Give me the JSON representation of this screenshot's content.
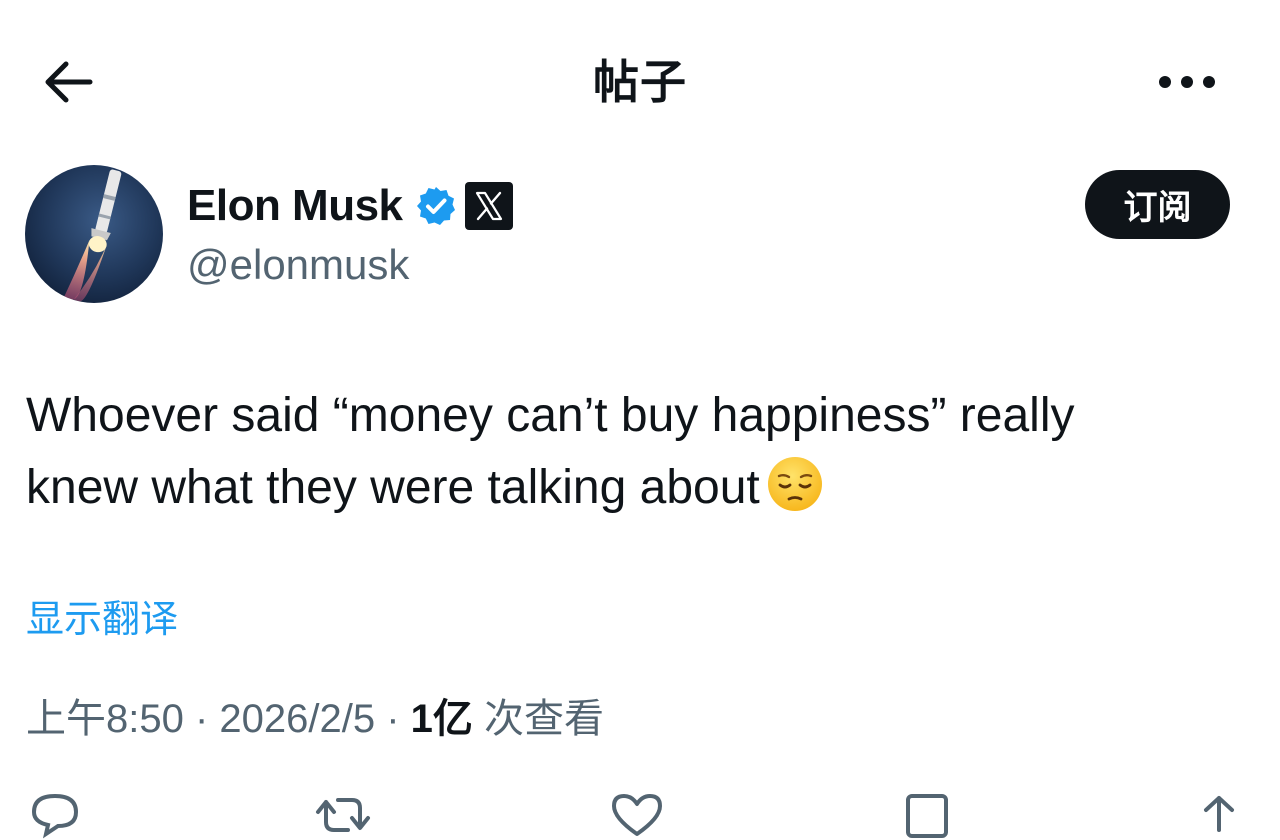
{
  "header": {
    "title": "帖子"
  },
  "author": {
    "name": "Elon Musk",
    "handle": "@elonmusk",
    "subscribe_label": "订阅"
  },
  "tweet": {
    "text_line1": "Whoever said “money can’t buy happiness” really",
    "text_line2": "knew what they were talking about",
    "emoji_icon": "pensive-face-icon",
    "translate_label": "显示翻译"
  },
  "meta": {
    "time": "上午8:50",
    "sep1": " · ",
    "date": "2026/2/5",
    "sep2": " · ",
    "views_count": "1亿",
    "views_label": " 次查看"
  },
  "colors": {
    "accent": "#1d9bf0",
    "text": "#0f1419",
    "secondary": "#536471"
  },
  "actions": {
    "reply_icon": "reply-icon",
    "retweet_icon": "retweet-icon",
    "like_icon": "like-icon",
    "bookmark_icon": "bookmark-icon",
    "share_icon": "share-icon"
  }
}
